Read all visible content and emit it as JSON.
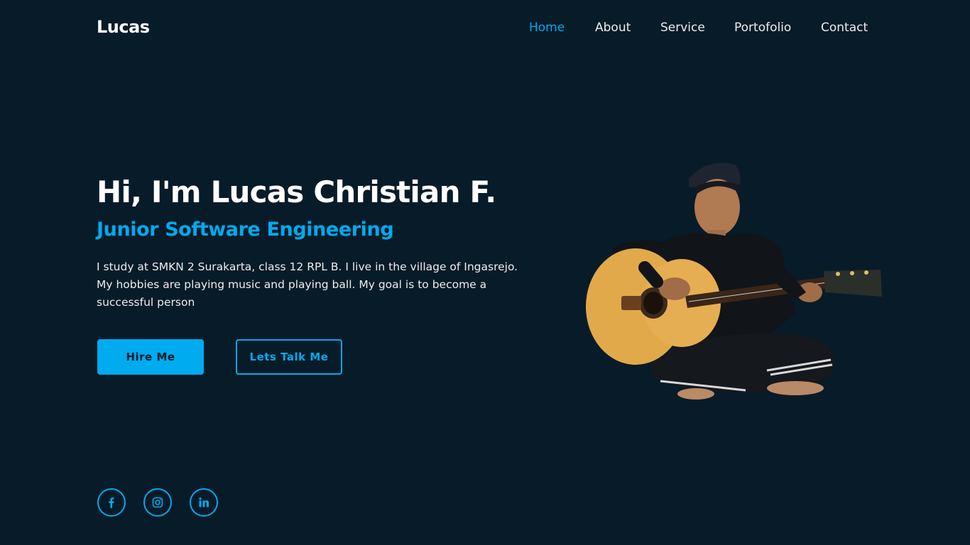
{
  "header": {
    "logo": "Lucas",
    "nav": [
      {
        "label": "Home",
        "active": true
      },
      {
        "label": "About",
        "active": false
      },
      {
        "label": "Service",
        "active": false
      },
      {
        "label": "Portofolio",
        "active": false
      },
      {
        "label": "Contact",
        "active": false
      }
    ]
  },
  "hero": {
    "title": "Hi, I'm Lucas Christian F.",
    "subtitle": "Junior Software Engineering",
    "description": "I study at SMKN 2 Surakarta, class 12 RPL B. I live in the village of Ingasrejo. My hobbies are playing music and playing ball. My goal is to become a successful person",
    "buttons": {
      "hire": "Hire Me",
      "talk": "Lets Talk Me"
    },
    "photo_icon": "person-with-guitar"
  },
  "social": [
    {
      "icon": "facebook-icon"
    },
    {
      "icon": "instagram-icon"
    },
    {
      "icon": "linkedin-icon"
    }
  ],
  "colors": {
    "background": "#081b29",
    "accent": "#00abf0",
    "text": "#ededed"
  }
}
